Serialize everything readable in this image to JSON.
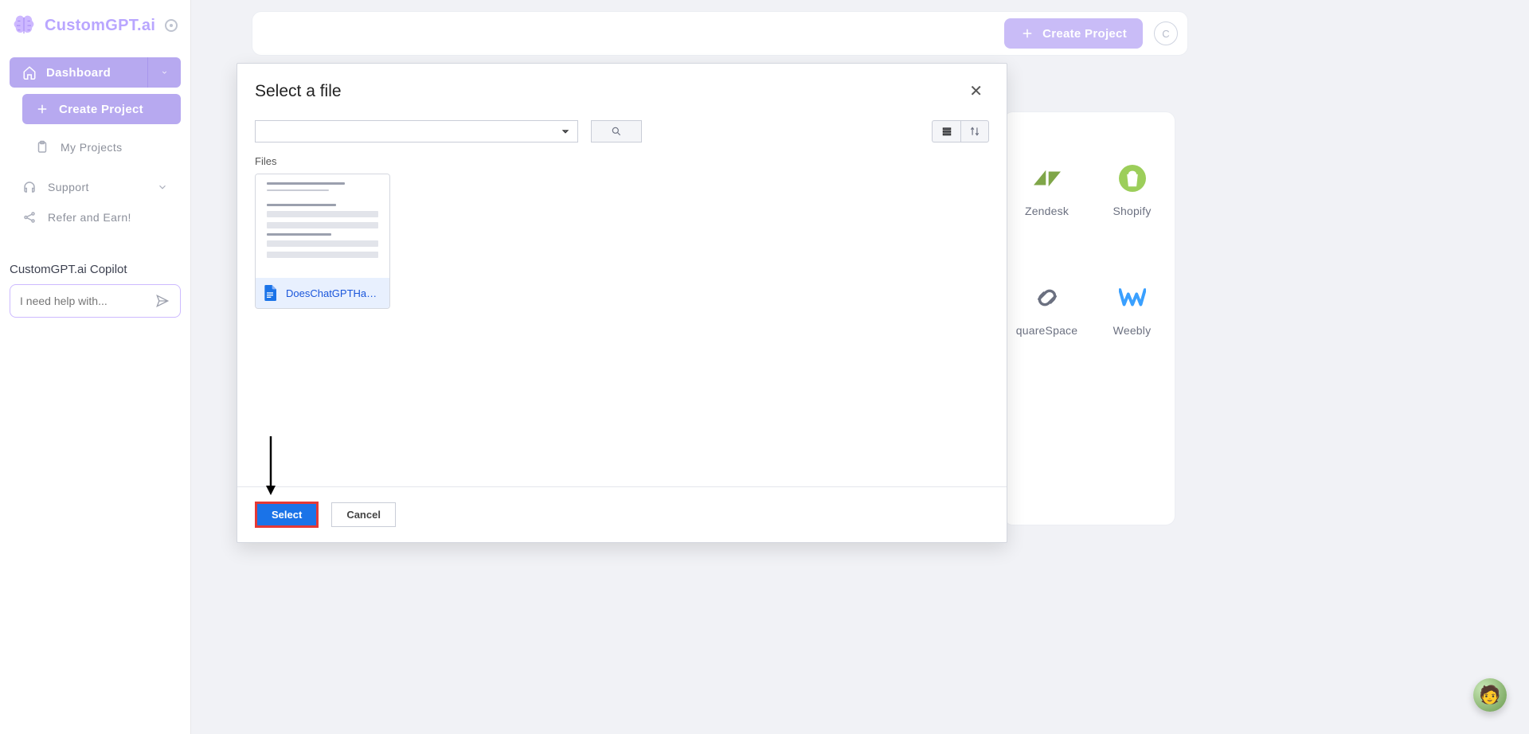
{
  "sidebar": {
    "brand": "CustomGPT.ai",
    "dashboard_label": "Dashboard",
    "create_project_label": "Create Project",
    "my_projects_label": "My Projects",
    "support_label": "Support",
    "refer_label": "Refer and Earn!",
    "copilot_title": "CustomGPT.ai Copilot",
    "copilot_placeholder": "I need help with..."
  },
  "header": {
    "create_project_label": "Create Project",
    "avatar_initial": "C"
  },
  "modal": {
    "title": "Select a file",
    "section_label": "Files",
    "file_name": "DoesChatGPTHav…",
    "select_label": "Select",
    "cancel_label": "Cancel"
  },
  "integrations": {
    "zendesk": "Zendesk",
    "shopify": "Shopify",
    "squarespace": "quareSpace",
    "weebly": "Weebly"
  }
}
